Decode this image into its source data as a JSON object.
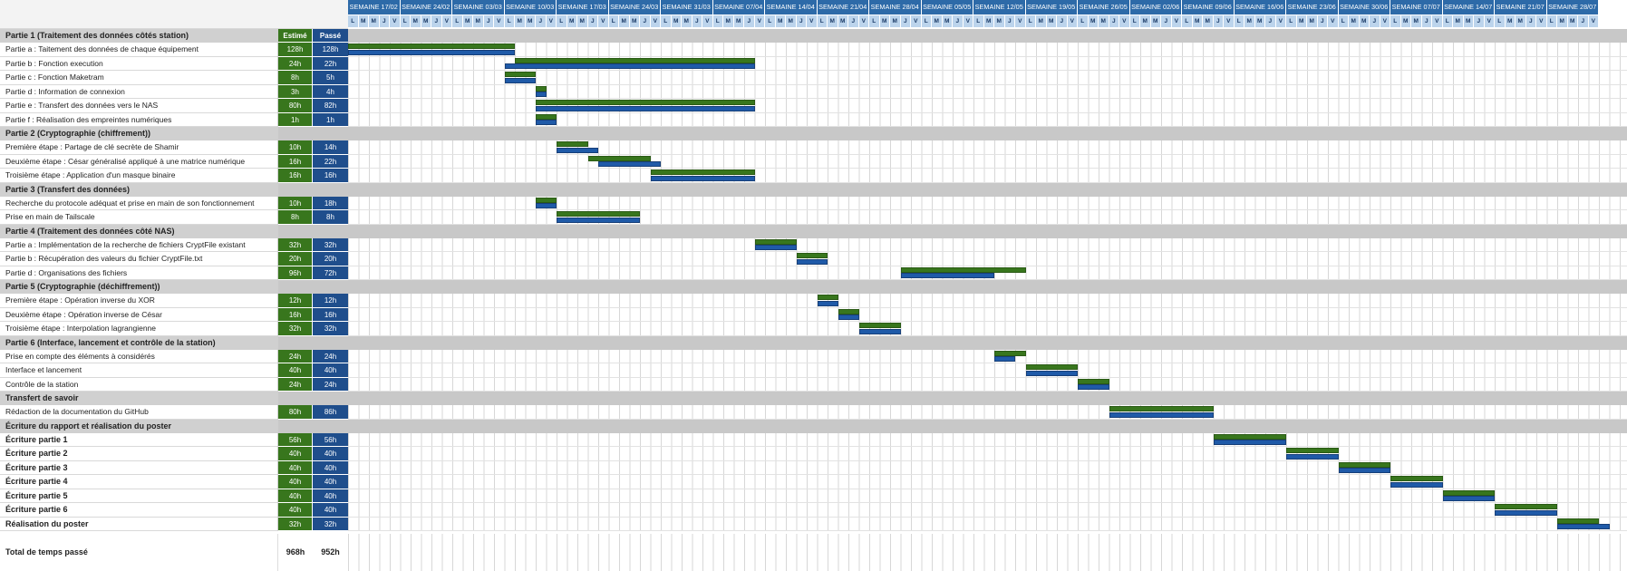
{
  "header": {
    "estime_label": "Estimé",
    "passe_label": "Passé",
    "weeks": [
      "SEMAINE 17/02",
      "SEMAINE 24/02",
      "SEMAINE 03/03",
      "SEMAINE 10/03",
      "SEMAINE 17/03",
      "SEMAINE 24/03",
      "SEMAINE 31/03",
      "SEMAINE 07/04",
      "SEMAINE 14/04",
      "SEMAINE 21/04",
      "SEMAINE 28/04",
      "SEMAINE 05/05",
      "SEMAINE 12/05",
      "SEMAINE 19/05",
      "SEMAINE 26/05",
      "SEMAINE 02/06",
      "SEMAINE 09/06",
      "SEMAINE 16/06",
      "SEMAINE 23/06",
      "SEMAINE 30/06",
      "SEMAINE 07/07",
      "SEMAINE 14/07",
      "SEMAINE 21/07",
      "SEMAINE 28/07"
    ],
    "day_letters": [
      "L",
      "M",
      "M",
      "J",
      "V"
    ]
  },
  "colors": {
    "estime": "#38761d",
    "passe": "#1f5aa8",
    "header": "#2d6aa8",
    "section": "#c8c8c8"
  },
  "rows": [
    {
      "kind": "section",
      "name": "Partie 1 (Traitement des données côtés station)",
      "est": "Estimé",
      "pas": "Passé"
    },
    {
      "kind": "task",
      "name": "Partie a : Taitement des données de chaque équipement",
      "est": "128h",
      "pas": "128h",
      "g": [
        0,
        16
      ],
      "b": [
        0,
        16
      ]
    },
    {
      "kind": "task",
      "name": "Partie b : Fonction execution",
      "est": "24h",
      "pas": "22h",
      "g": [
        16,
        39
      ],
      "b": [
        15,
        39
      ]
    },
    {
      "kind": "task",
      "name": "Partie c : Fonction Maketram",
      "est": "8h",
      "pas": "5h",
      "g": [
        15,
        18
      ],
      "b": [
        15,
        18
      ]
    },
    {
      "kind": "task",
      "name": "Partie d : Information de connexion",
      "est": "3h",
      "pas": "4h",
      "g": [
        18,
        19
      ],
      "b": [
        18,
        19
      ]
    },
    {
      "kind": "task",
      "name": "Partie e : Transfert des données vers le NAS",
      "est": "80h",
      "pas": "82h",
      "g": [
        18,
        39
      ],
      "b": [
        18,
        39
      ]
    },
    {
      "kind": "task",
      "name": "Partie f : Réalisation des empreintes numériques",
      "est": "1h",
      "pas": "1h",
      "g": [
        18,
        20
      ],
      "b": [
        18,
        20
      ]
    },
    {
      "kind": "section",
      "name": "Partie 2 (Cryptographie (chiffrement))"
    },
    {
      "kind": "task",
      "name": "Première étape : Partage de clé secrète de Shamir",
      "est": "10h",
      "pas": "14h",
      "g": [
        20,
        23
      ],
      "b": [
        20,
        24
      ]
    },
    {
      "kind": "task",
      "name": "Deuxième étape : César généralisé appliqué à une matrice numérique",
      "est": "16h",
      "pas": "22h",
      "g": [
        23,
        29
      ],
      "b": [
        24,
        30
      ]
    },
    {
      "kind": "task",
      "name": "Troisième étape : Application d'un masque binaire",
      "est": "16h",
      "pas": "16h",
      "g": [
        29,
        39
      ],
      "b": [
        29,
        39
      ]
    },
    {
      "kind": "section",
      "name": "Partie 3 (Transfert des données)"
    },
    {
      "kind": "task",
      "name": "Recherche du protocole adéquat et prise en main de son fonctionnement",
      "est": "10h",
      "pas": "18h",
      "g": [
        18,
        20
      ],
      "b": [
        18,
        20
      ]
    },
    {
      "kind": "task",
      "name": "Prise en main de Tailscale",
      "est": "8h",
      "pas": "8h",
      "g": [
        20,
        28
      ],
      "b": [
        20,
        28
      ]
    },
    {
      "kind": "section",
      "name": "Partie 4 (Traitement des données côté NAS)"
    },
    {
      "kind": "task",
      "name": "Partie a : Implémentation de la recherche de fichiers CryptFile existant",
      "est": "32h",
      "pas": "32h",
      "g": [
        39,
        43
      ],
      "b": [
        39,
        43
      ]
    },
    {
      "kind": "task",
      "name": "Partie b : Récupération des valeurs du fichier CryptFile.txt",
      "est": "20h",
      "pas": "20h",
      "g": [
        43,
        46
      ],
      "b": [
        43,
        46
      ]
    },
    {
      "kind": "task",
      "name": "Partie d : Organisations des fichiers",
      "est": "96h",
      "pas": "72h",
      "g": [
        53,
        65
      ],
      "b": [
        53,
        62
      ]
    },
    {
      "kind": "section",
      "name": "Partie 5 (Cryptographie (déchiffrement))"
    },
    {
      "kind": "task",
      "name": "Première étape : Opération inverse du XOR",
      "est": "12h",
      "pas": "12h",
      "g": [
        45,
        47
      ],
      "b": [
        45,
        47
      ]
    },
    {
      "kind": "task",
      "name": "Deuxième étape : Opération inverse de César",
      "est": "16h",
      "pas": "16h",
      "g": [
        47,
        49
      ],
      "b": [
        47,
        49
      ]
    },
    {
      "kind": "task",
      "name": "Troisième étape : Interpolation lagrangienne",
      "est": "32h",
      "pas": "32h",
      "g": [
        49,
        53
      ],
      "b": [
        49,
        53
      ]
    },
    {
      "kind": "section",
      "name": "Partie 6 (Interface, lancement et contrôle de la station)"
    },
    {
      "kind": "task",
      "name": "Prise en compte des éléments à considérés",
      "est": "24h",
      "pas": "24h",
      "g": [
        62,
        65
      ],
      "b": [
        62,
        64
      ]
    },
    {
      "kind": "task",
      "name": "Interface et lancement",
      "est": "40h",
      "pas": "40h",
      "g": [
        65,
        70
      ],
      "b": [
        65,
        70
      ]
    },
    {
      "kind": "task",
      "name": "Contrôle de la station",
      "est": "24h",
      "pas": "24h",
      "g": [
        70,
        73
      ],
      "b": [
        70,
        73
      ]
    },
    {
      "kind": "section",
      "name": "Transfert de savoir"
    },
    {
      "kind": "task",
      "name": "Rédaction de la documentation du GitHub",
      "est": "80h",
      "pas": "86h",
      "g": [
        73,
        83
      ],
      "b": [
        73,
        83
      ]
    },
    {
      "kind": "section",
      "name": "Écriture du rapport et réalisation du poster"
    },
    {
      "kind": "task",
      "bold": true,
      "name": "Écriture partie 1",
      "est": "56h",
      "pas": "56h",
      "g": [
        83,
        90
      ],
      "b": [
        83,
        90
      ]
    },
    {
      "kind": "task",
      "bold": true,
      "name": "Écriture partie 2",
      "est": "40h",
      "pas": "40h",
      "g": [
        90,
        95
      ],
      "b": [
        90,
        95
      ]
    },
    {
      "kind": "task",
      "bold": true,
      "name": "Écriture partie 3",
      "est": "40h",
      "pas": "40h",
      "g": [
        95,
        100
      ],
      "b": [
        95,
        100
      ]
    },
    {
      "kind": "task",
      "bold": true,
      "name": "Écriture partie 4",
      "est": "40h",
      "pas": "40h",
      "g": [
        100,
        105
      ],
      "b": [
        100,
        105
      ]
    },
    {
      "kind": "task",
      "bold": true,
      "name": "Écriture partie 5",
      "est": "40h",
      "pas": "40h",
      "g": [
        105,
        110
      ],
      "b": [
        105,
        110
      ]
    },
    {
      "kind": "task",
      "bold": true,
      "name": "Écriture partie 6",
      "est": "40h",
      "pas": "40h",
      "g": [
        110,
        116
      ],
      "b": [
        110,
        116
      ]
    },
    {
      "kind": "task",
      "bold": true,
      "name": "Réalisation du poster",
      "est": "32h",
      "pas": "32h",
      "g": [
        116,
        120
      ],
      "b": [
        116,
        121
      ]
    }
  ],
  "total": {
    "label": "Total de temps passé",
    "est": "968h",
    "pas": "952h"
  }
}
